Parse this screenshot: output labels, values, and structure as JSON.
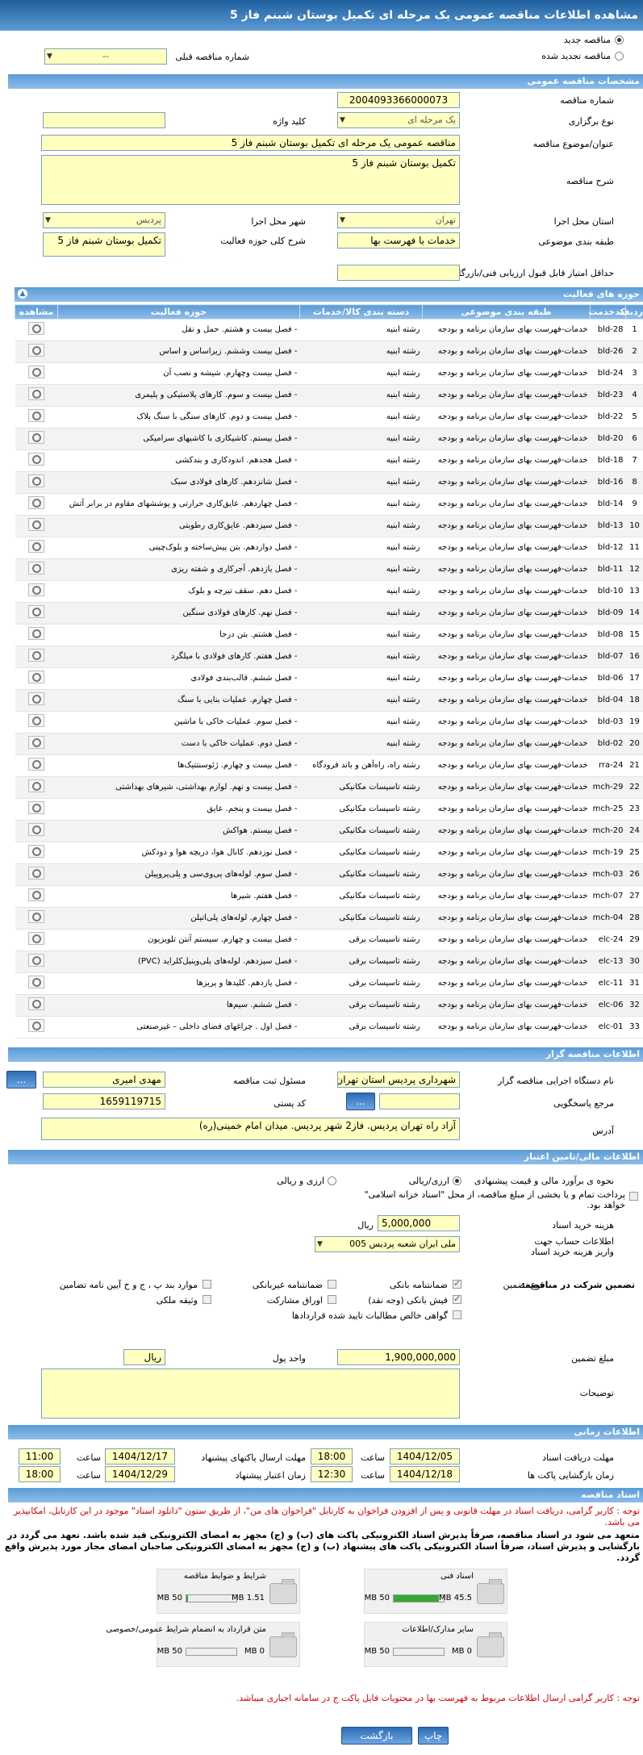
{
  "page_title": "مشاهده اطلاعات مناقصه عمومی یک مرحله ای تکمیل بوستان شبنم فاز 5",
  "top": {
    "new_tender": "مناقصه جدید",
    "renewed_tender": "مناقصه تجدید شده",
    "prev_number_label": "شماره مناقصه قبلی",
    "prev_number_value": "--"
  },
  "spec": {
    "section": "مشخصات مناقصه عمومی",
    "number_label": "شماره مناقصه",
    "number_value": "2004093366000073",
    "type_label": "نوع برگزاری",
    "type_value": "یک مرحله ای",
    "keyword_label": "کلید واژه",
    "keyword_value": "",
    "title_label": "عنوان/موضوع مناقصه",
    "title_value": "مناقصه عمومی یک مرحله ای تکمیل بوستان شبنم فاز 5",
    "desc_label": "شرح مناقصه",
    "desc_value": "تکمیل بوستان شبنم فاز 5",
    "province_label": "استان محل اجرا",
    "province_value": "تهران",
    "city_label": "شهر محل اجرا",
    "city_value": "پردیس",
    "category_label": "طبقه بندی موضوعی",
    "category_value": "خدمات با فهرست بها",
    "scope_label": "شرح کلی حوزه فعالیت",
    "scope_value": "تکمیل بوستان شبنم فاز 5",
    "minscore_label": "حداقل امتیاز قابل قبول ارزیابی فنی/بازرگانی",
    "minscore_value": ""
  },
  "activities": {
    "section": "حوزه های فعالیت",
    "headers": [
      "ردیف",
      "کدخدمت",
      "طبقه بندی موضوعی",
      "دسته بندی کالا/خدمات",
      "حوزه فعالیت",
      "مشاهده"
    ],
    "rows": [
      [
        "1",
        "bld-28",
        "خدمات-فهرست بهای سازمان برنامه و بودجه",
        "رشته ابنیه",
        "- فصل بیست و هشتم. حمل و نقل"
      ],
      [
        "2",
        "bld-26",
        "خدمات-فهرست بهای سازمان برنامه و بودجه",
        "رشته ابنیه",
        "- فصل بیست وششم. زیراساس و اساس"
      ],
      [
        "3",
        "bld-24",
        "خدمات-فهرست بهای سازمان برنامه و بودجه",
        "رشته ابنیه",
        "- فصل بیست وچهارم. شیشه و نصب آن"
      ],
      [
        "4",
        "bld-23",
        "خدمات-فهرست بهای سازمان برنامه و بودجه",
        "رشته ابنیه",
        "- فصل بیست و سوم. کارهای پلاستیکی و پلیمری"
      ],
      [
        "5",
        "bld-22",
        "خدمات-فهرست بهای سازمان برنامه و بودجه",
        "رشته ابنیه",
        "- فصل بیست و دوم. کارهای سنگی با سنگ پلاک"
      ],
      [
        "6",
        "bld-20",
        "خدمات-فهرست بهای سازمان برنامه و بودجه",
        "رشته ابنیه",
        "- فصل بیستم. کاشیکاری با کاشیهای سرامیکی"
      ],
      [
        "7",
        "bld-18",
        "خدمات-فهرست بهای سازمان برنامه و بودجه",
        "رشته ابنیه",
        "- فصل هجدهم. اندودکاری و بندکشی"
      ],
      [
        "8",
        "bld-16",
        "خدمات-فهرست بهای سازمان برنامه و بودجه",
        "رشته ابنیه",
        "- فصل شانزدهم. کارهای فولادی سبک"
      ],
      [
        "9",
        "bld-14",
        "خدمات-فهرست بهای سازمان برنامه و بودجه",
        "رشته ابنیه",
        "- فصل چهاردهم. عایق‌کاری حرارتی و پوششهای مقاوم در برابر آتش"
      ],
      [
        "10",
        "bld-13",
        "خدمات-فهرست بهای سازمان برنامه و بودجه",
        "رشته ابنیه",
        "- فصل سیزدهم. عایق‌کاری رطوبتی"
      ],
      [
        "11",
        "bld-12",
        "خدمات-فهرست بهای سازمان برنامه و بودجه",
        "رشته ابنیه",
        "- فصل دوازدهم. بتن پیش‌ساخته و بلوک‌چینی"
      ],
      [
        "12",
        "bld-11",
        "خدمات-فهرست بهای سازمان برنامه و بودجه",
        "رشته ابنیه",
        "- فصل یازدهم. آجرکاری و شفته ریزی"
      ],
      [
        "13",
        "bld-10",
        "خدمات-فهرست بهای سازمان برنامه و بودجه",
        "رشته ابنیه",
        "- فصل دهم. سقف تیرچه و بلوک"
      ],
      [
        "14",
        "bld-09",
        "خدمات-فهرست بهای سازمان برنامه و بودجه",
        "رشته ابنیه",
        "- فصل نهم. کارهای فولادی سنگین"
      ],
      [
        "15",
        "bld-08",
        "خدمات-فهرست بهای سازمان برنامه و بودجه",
        "رشته ابنیه",
        "- فصل هشتم. بتن درجا"
      ],
      [
        "16",
        "bld-07",
        "خدمات-فهرست بهای سازمان برنامه و بودجه",
        "رشته ابنیه",
        "- فصل هفتم. کارهای فولادی با میلگرد"
      ],
      [
        "17",
        "bld-06",
        "خدمات-فهرست بهای سازمان برنامه و بودجه",
        "رشته ابنیه",
        "- فصل ششم. قالب‌بندی فولادی"
      ],
      [
        "18",
        "bld-04",
        "خدمات-فهرست بهای سازمان برنامه و بودجه",
        "رشته ابنیه",
        "- فصل چهارم. عملیات بنایی با سنگ"
      ],
      [
        "19",
        "bld-03",
        "خدمات-فهرست بهای سازمان برنامه و بودجه",
        "رشته ابنیه",
        "- فصل سوم. عملیات خاکی با ماشین"
      ],
      [
        "20",
        "bld-02",
        "خدمات-فهرست بهای سازمان برنامه و بودجه",
        "رشته ابنیه",
        "- فصل دوم. عملیات خاکی با دست"
      ],
      [
        "21",
        "rra-24",
        "خدمات-فهرست بهای سازمان برنامه و بودجه",
        "رشته راه، راه‌آهن و باند فرودگاه",
        "- فصل بیست و چهارم. ژئوسنتتیک‌ها"
      ],
      [
        "22",
        "mch-29",
        "خدمات-فهرست بهای سازمان برنامه و بودجه",
        "رشته تاسیسات مکانیکی",
        "- فصل بیست و نهم. لوازم بهداشتی، شیرهای بهداشتی"
      ],
      [
        "23",
        "mch-25",
        "خدمات-فهرست بهای سازمان برنامه و بودجه",
        "رشته تاسیسات مکانیکی",
        "- فصل بیست و پنجم. عایق"
      ],
      [
        "24",
        "mch-20",
        "خدمات-فهرست بهای سازمان برنامه و بودجه",
        "رشته تاسیسات مکانیکی",
        "- فصل بیستم. هواکش"
      ],
      [
        "25",
        "mch-19",
        "خدمات-فهرست بهای سازمان برنامه و بودجه",
        "رشته تاسیسات مکانیکی",
        "- فصل نوزدهم. کانال هوا، دریچه هوا و دودکش"
      ],
      [
        "26",
        "mch-03",
        "خدمات-فهرست بهای سازمان برنامه و بودجه",
        "رشته تاسیسات مکانیکی",
        "- فصل سوم. لوله‌های پی‌وی‌سی و پلی‌پروپیلن"
      ],
      [
        "27",
        "mch-07",
        "خدمات-فهرست بهای سازمان برنامه و بودجه",
        "رشته تاسیسات مکانیکی",
        "- فصل هفتم. شیرها"
      ],
      [
        "28",
        "mch-04",
        "خدمات-فهرست بهای سازمان برنامه و بودجه",
        "رشته تاسیسات مکانیکی",
        "- فصل چهارم. لوله‌های پلی‌اتیلن"
      ],
      [
        "29",
        "elc-24",
        "خدمات-فهرست بهای سازمان برنامه و بودجه",
        "رشته تاسیسات برقی",
        "- فصل بیست و چهارم. سیستم آنتن تلویزیون"
      ],
      [
        "30",
        "elc-13",
        "خدمات-فهرست بهای سازمان برنامه و بودجه",
        "رشته تاسیسات برقی",
        "- فصل سیزدهم. لوله‌های پلی‌وینیل‌کلراید (PVC)"
      ],
      [
        "31",
        "elc-11",
        "خدمات-فهرست بهای سازمان برنامه و بودجه",
        "رشته تاسیسات برقی",
        "- فصل یازدهم. کلیدها و پریزها"
      ],
      [
        "32",
        "elc-06",
        "خدمات-فهرست بهای سازمان برنامه و بودجه",
        "رشته تاسیسات برقی",
        "- فصل ششم. سیم‌ها"
      ],
      [
        "33",
        "elc-01",
        "خدمات-فهرست بهای سازمان برنامه و بودجه",
        "رشته تاسیسات برقی",
        "- فصل اول . چراغهای فضای داخلی – غیرصنعتی"
      ]
    ]
  },
  "organizer": {
    "section": "اطلاعات مناقصه گزار",
    "org_label": "نام دستگاه اجرایی مناقصه گزار",
    "org_value": "شهرداری پردیس استان تهران",
    "resp_label": "مسئول ثبت مناقصه",
    "resp_value": "مهدی امیری",
    "ref_label": "مرجع پاسخگویی",
    "ref_value": "",
    "postal_label": "کد پستی",
    "postal_value": "1659119715",
    "address_label": "آدرس",
    "address_value": "آزاد راه تهران پردیس. فاز2 شهر پردیس. میدان امام خمینی(ره)",
    "dots": "..."
  },
  "finance": {
    "section": "اطلاعات مالی/تامین اعتبار",
    "estimate_label": "نحوه ی برآورد مالی و قیمت پیشنهادی",
    "estimate_opt1": "ارزی/ریالی",
    "estimate_opt2": "ارزی و ریالی",
    "treasury_text": "پرداخت تمام و یا بخشی از مبلغ مناقصه، از محل \"اسناد خزانه اسلامی\" خواهد بود.",
    "doc_cost_label": "هزینه خرید اسناد",
    "doc_cost_value": "5,000,000",
    "currency": "ریال",
    "account_label": "اطلاعات حساب جهت واریز هزینه خرید اسناد",
    "account_value": "ملی ایران شعبه پردیس 005",
    "guarantee_label": "تضمین شرکت در مناقصه:",
    "guarantee_type": "نوع تضمین",
    "g1": "ضمانتنامه بانکی",
    "g2": "ضمانتنامه غیربانکی",
    "g3": "موارد بند پ ، ج و ح آیین نامه تضامین",
    "g4": "فیش بانکی (وجه نقد)",
    "g5": "اوراق مشارکت",
    "g6": "وثیقه ملکی",
    "g7": "گواهی خالص مطالبات تایید شده قراردادها",
    "amount_label": "مبلغ تضمین",
    "amount_value": "1,900,000,000",
    "unit_label": "واحد پول",
    "unit_value": "ریال",
    "notes_label": "توضیحات",
    "notes_value": ""
  },
  "timing": {
    "section": "اطلاعات زمانی",
    "receive_label": "مهلت دریافت اسناد",
    "receive_date": "1404/12/05",
    "receive_time": "18:00",
    "send_label": "مهلت ارسال پاکتهای پیشنهاد",
    "send_date": "1404/12/17",
    "send_time": "11:00",
    "open_label": "زمان بازگشایی پاکت ها",
    "open_date": "1404/12/18",
    "open_time": "12:30",
    "validity_label": "زمان اعتبار پیشنهاد",
    "validity_date": "1404/12/29",
    "validity_time": "18:00",
    "hour": "ساعت"
  },
  "docs": {
    "section": "اسناد مناقصه",
    "warn1": "توجه : کاربر گرامی، دریافت اسناد در مهلت قانونی و پس از افزودن فراخوان به کارتابل \"فراخوان های من\"، از طریق ستون \"دانلود اسناد\" موجود در این کارتابل، امکانپذیر می باشد.",
    "bold": "متعهد می شود در اسناد مناقصه، صرفاً پذیرش اسناد الکترونیکی پاکت های (ب) و (ج) مجهز به امضای الکترونیکی قید شده باشد. تعهد می گردد در بارگشایی و پذیرش اسناد، صرفاً اسناد الکترونیکی پاکت های پیشنهاد (ب) و (ج) مجهز به امضای الکترونیکی صاحبان امضای مجاز مورد پذیرش واقع گردد.",
    "files": [
      {
        "name": "شرایط و ضوابط مناقصه",
        "size": "1.51 MB",
        "max": "50 MB",
        "fill": 0.03
      },
      {
        "name": "اسناد فنی",
        "size": "45.5 MB",
        "max": "50 MB",
        "fill": 0.91
      },
      {
        "name": "متن قرارداد به انضمام شرایط عمومی/خصوصی",
        "size": "0 MB",
        "max": "50 MB",
        "fill": 0
      },
      {
        "name": "سایر مدارک/اطلاعات",
        "size": "0 MB",
        "max": "50 MB",
        "fill": 0
      }
    ],
    "warn2": "توجه : کاربر گرامی ارسال اطلاعات مربوط به فهرست بها در محتویات فایل پاکت ج در سامانه اجباری میباشد."
  },
  "footer": {
    "print": "چاپ",
    "back": "بازگشت"
  },
  "colors": {
    "header": "#1f5f9d",
    "section": "#5a9bd8",
    "field": "#ffffc0",
    "warning": "#d00000"
  }
}
